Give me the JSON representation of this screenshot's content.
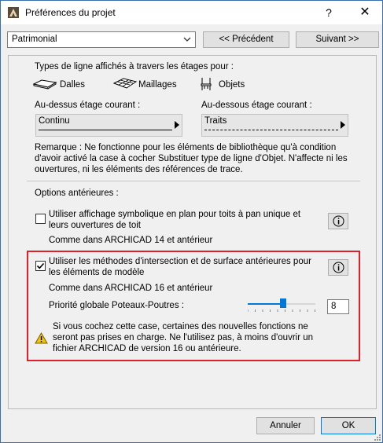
{
  "window": {
    "title": "Préférences du projet",
    "help_label": "?",
    "close_label": "✕"
  },
  "top": {
    "combo_value": "Patrimonial",
    "prev_label": "<< Précédent",
    "next_label": "Suivant >>"
  },
  "line_types": {
    "heading": "Types de ligne affichés à travers les étages pour :",
    "dalles": "Dalles",
    "maillages": "Maillages",
    "objets": "Objets",
    "above_label": "Au-dessus étage courant :",
    "above_value": "Continu",
    "below_label": "Au-dessous étage courant :",
    "below_value": "Traits",
    "remark": "Remarque : Ne fonctionne pour les éléments de bibliothèque qu'à condition d'avoir activé la case à cocher Substituer type de ligne d'Objet. N'affecte ni les ouvertures, ni les éléments des références de trace."
  },
  "legacy": {
    "heading": "Options antérieures :",
    "opt1_label": "Utiliser affichage symbolique en plan pour toits à pan unique et leurs ouvertures de toit",
    "opt1_checked": false,
    "opt1_note": "Comme dans ARCHICAD 14 et antérieur",
    "opt2_label": "Utiliser les méthodes d'intersection et de surface antérieures pour les éléments de modèle",
    "opt2_checked": true,
    "opt2_note": "Comme dans ARCHICAD 16 et antérieur",
    "priority_label": "Priorité globale Poteaux-Poutres :",
    "priority_value": "8",
    "priority_level_fraction": 0.5,
    "warning": "Si vous cochez cette case, certaines des nouvelles fonctions ne seront pas prises en charge. Ne l'utilisez pas, à moins d'ouvrir un fichier ARCHICAD de version 16 ou antérieure."
  },
  "footer": {
    "cancel_label": "Annuler",
    "ok_label": "OK"
  },
  "colors": {
    "highlight_border": "#e0202a",
    "accent": "#0078d7"
  },
  "icons": [
    "archicad-app-icon",
    "slab-icon",
    "mesh-icon",
    "object-chair-icon",
    "info-icon",
    "warning-icon",
    "checkmark-icon",
    "resize-grip-icon"
  ]
}
